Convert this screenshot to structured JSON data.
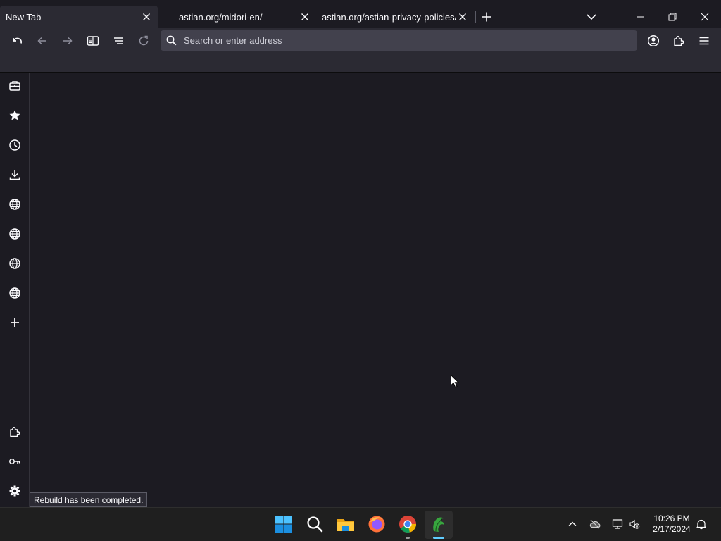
{
  "tabs": [
    {
      "label": "New Tab",
      "active": true
    },
    {
      "label": "astian.org/midori-en/",
      "active": false
    },
    {
      "label": "astian.org/astian-privacy-policies/",
      "active": false
    }
  ],
  "tabstrip": {
    "new_tab_icon": "plus-icon",
    "list_all_tabs_icon": "chevron-down-icon",
    "window_controls": [
      "minimize-icon",
      "restore-icon",
      "close-icon"
    ]
  },
  "toolbar": {
    "left_buttons": [
      "undo-icon",
      "back-icon",
      "forward-icon",
      "reader-view-icon",
      "tab-list-icon",
      "reload-icon"
    ],
    "right_buttons": [
      "account-icon",
      "extensions-icon",
      "menu-icon"
    ]
  },
  "address_bar": {
    "placeholder": "Search or enter address",
    "value": ""
  },
  "sidebar": {
    "items": [
      "toolbox-icon",
      "bookmarks-star-icon",
      "history-clock-icon",
      "downloads-icon",
      "web-panel-globe-icon",
      "web-panel-globe-icon",
      "web-panel-globe-icon",
      "web-panel-globe-icon",
      "add-panel-plus-icon"
    ],
    "bottom_items": [
      "extensions-icon",
      "passwords-key-icon",
      "settings-gear-icon"
    ]
  },
  "status_message": "Rebuild has been completed.",
  "taskbar": {
    "apps": [
      "windows-start-icon",
      "search-icon",
      "file-explorer-icon",
      "firefox-icon",
      "chrome-icon",
      "midori-icon"
    ],
    "tray": [
      "show-hidden-icons-chevron",
      "onedrive-offline-icon",
      "network-icon",
      "volume-muted-icon",
      "notifications-bell-icon"
    ],
    "time": "10:26 PM",
    "date": "2/17/2024"
  },
  "colors": {
    "chrome_bg": "#1c1b22",
    "toolbar_bg": "#2b2a33",
    "urlbar_bg": "#42414d",
    "taskbar_bg": "#1f1f1f",
    "accent": "#60cdff"
  }
}
